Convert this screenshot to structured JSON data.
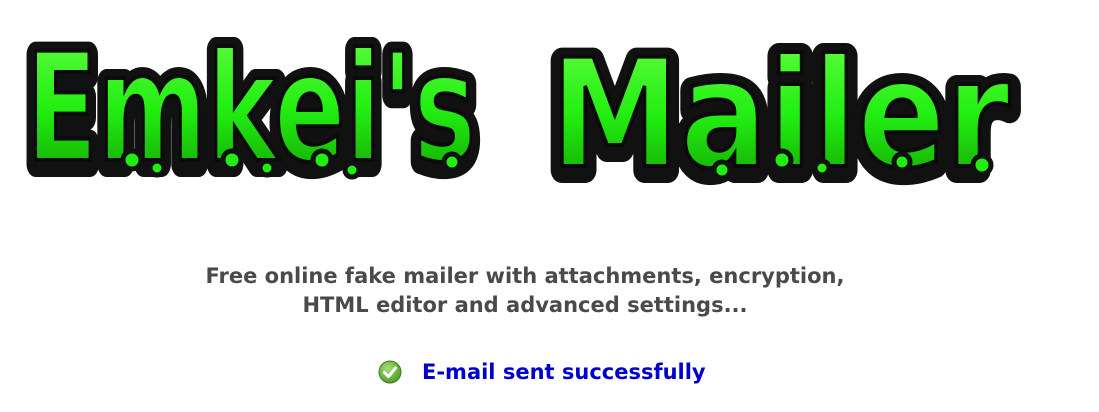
{
  "logo": {
    "alt_text": "Emkei's Mailer",
    "fill_color": "#22ee11",
    "outline_color": "#111111"
  },
  "tagline": {
    "line1": "Free online fake mailer with attachments, encryption,",
    "line2": "HTML editor and advanced settings..."
  },
  "status": {
    "icon": "check-circle-icon",
    "icon_color": "#66bb33",
    "message": "E-mail sent successfully",
    "message_color": "#0000cc"
  }
}
